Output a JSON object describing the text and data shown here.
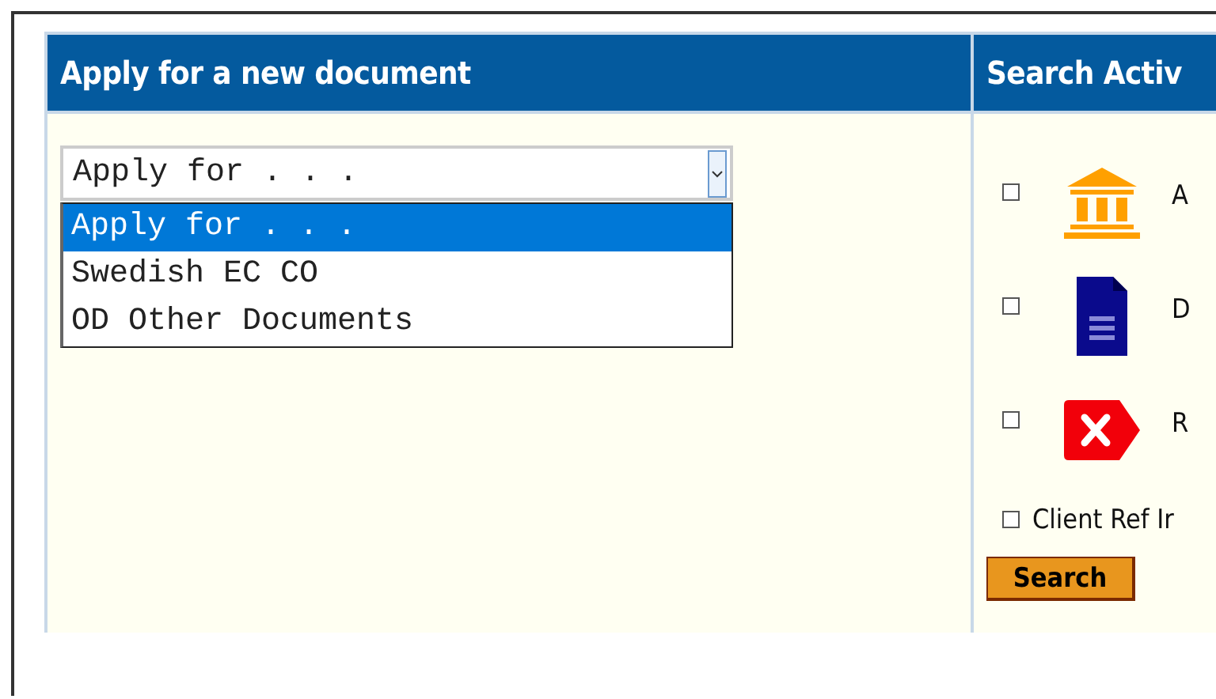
{
  "apply_panel": {
    "title": "Apply for a new document",
    "select": {
      "value": "Apply for . . .",
      "open": true,
      "options": [
        {
          "label": "Apply for . . .",
          "selected": true
        },
        {
          "label": "Swedish EC CO",
          "selected": false
        },
        {
          "label": "OD Other Documents",
          "selected": false
        }
      ]
    }
  },
  "search_panel": {
    "title": "Search Activ",
    "filters": [
      {
        "kind": "bank",
        "label": "A",
        "checked": false
      },
      {
        "kind": "document",
        "label": "D",
        "checked": false
      },
      {
        "kind": "rejected",
        "label": "R",
        "checked": false
      },
      {
        "kind": "plain",
        "label": "Client Ref Ir",
        "checked": false
      }
    ],
    "button": "Search"
  }
}
